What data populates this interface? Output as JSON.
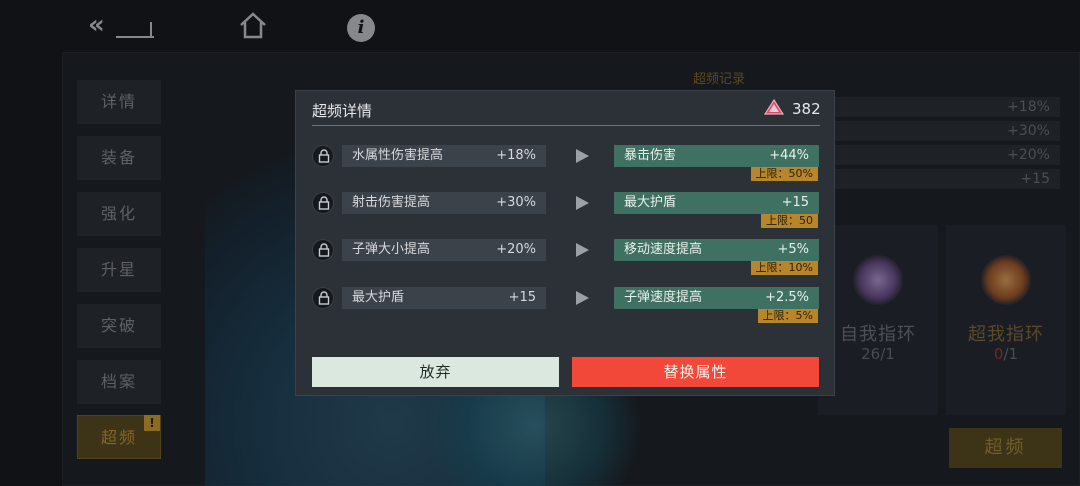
{
  "sidebar": {
    "items": [
      {
        "label": "详情"
      },
      {
        "label": "装备"
      },
      {
        "label": "强化"
      },
      {
        "label": "升星"
      },
      {
        "label": "突破"
      },
      {
        "label": "档案"
      },
      {
        "label": "超频",
        "badge": "!"
      }
    ]
  },
  "history": {
    "title": "超频记录",
    "rows": [
      "+18%",
      "+30%",
      "+20%",
      "+15"
    ]
  },
  "rings": [
    {
      "name": "自我指环",
      "count_current": "26",
      "count_suffix": "/1",
      "name_color": "#6f7980",
      "count_color": "#6c7178"
    },
    {
      "name": "超我指环",
      "count_current": "0",
      "count_suffix": "/1",
      "name_color": "#8a6a3a",
      "count_color": "#a83b2d"
    }
  ],
  "overclock_button_label": "超频",
  "modal": {
    "title": "超频详情",
    "currency_value": "382",
    "rows": [
      {
        "old_name": "水属性伤害提高",
        "old_value": "+18%",
        "new_name": "暴击伤害",
        "new_value": "+44%",
        "limit": "上限：50%"
      },
      {
        "old_name": "射击伤害提高",
        "old_value": "+30%",
        "new_name": "最大护盾",
        "new_value": "+15",
        "limit": "上限：50"
      },
      {
        "old_name": "子弹大小提高",
        "old_value": "+20%",
        "new_name": "移动速度提高",
        "new_value": "+5%",
        "limit": "上限：10%"
      },
      {
        "old_name": "最大护盾",
        "old_value": "+15",
        "new_name": "子弹速度提高",
        "new_value": "+2.5%",
        "limit": "上限：5%"
      }
    ],
    "abandon_label": "放弃",
    "replace_label": "替换属性"
  },
  "colors": {
    "accent_gold": "#c89a2e",
    "replace_red": "#f2483a",
    "new_attr_green": "#3f7163",
    "limit_amber": "#b8862a"
  }
}
